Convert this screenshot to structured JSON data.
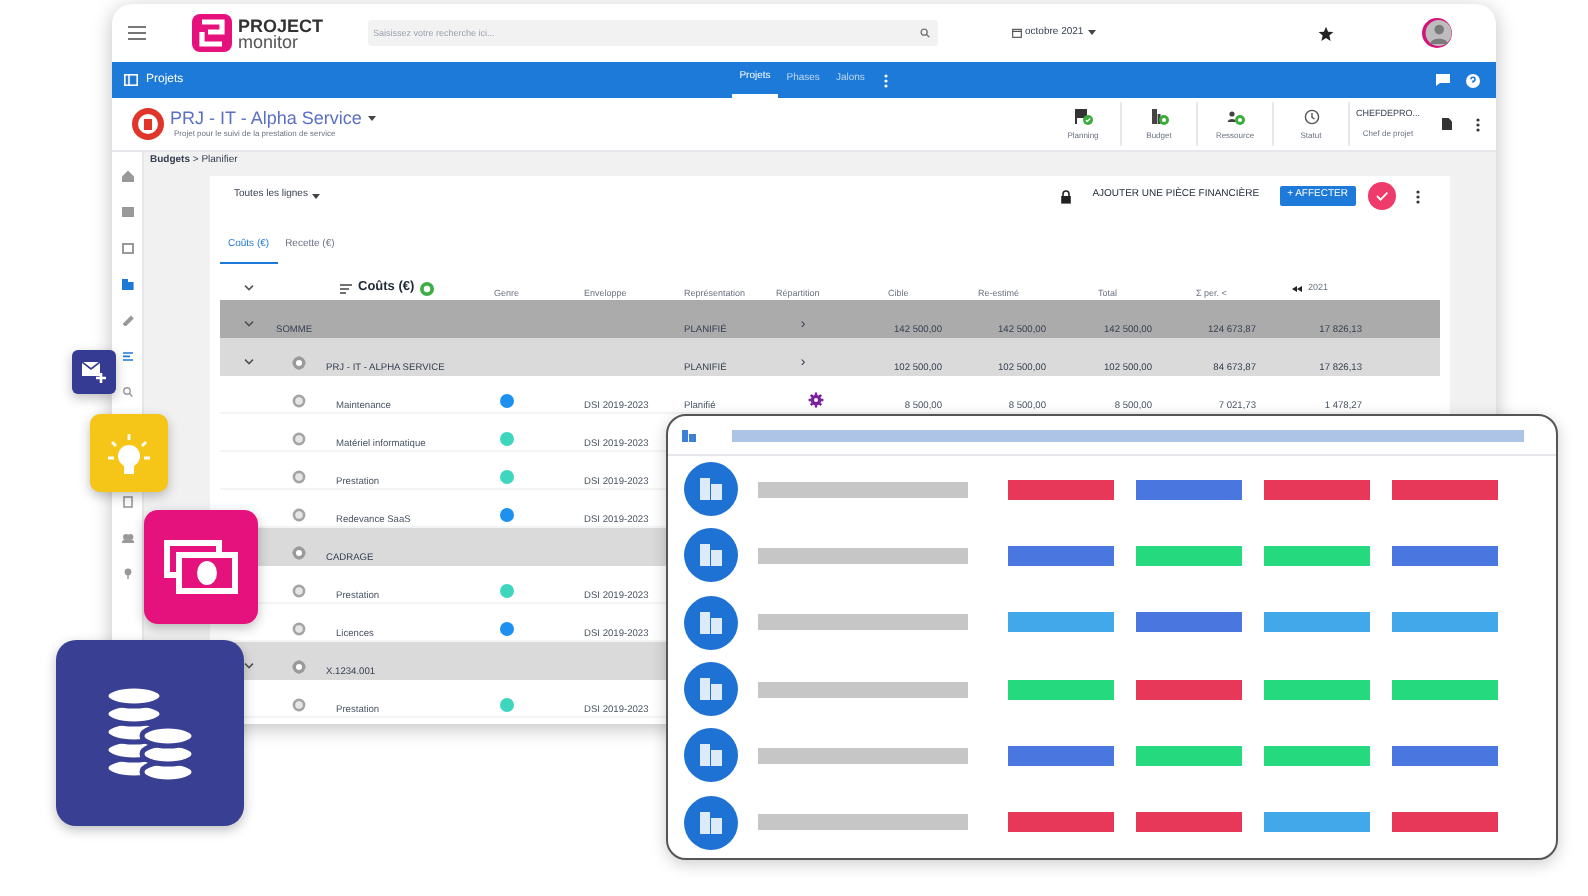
{
  "app": {
    "logo_line1": "PROJECT",
    "logo_line2": "monitor",
    "search": {
      "placeholder": "Saisissez votre recherche ici..."
    },
    "period": "octobre 2021"
  },
  "nav": {
    "title": "Projets",
    "tabs": [
      {
        "label": "Projets",
        "selected": true
      },
      {
        "label": "Phases",
        "selected": false
      },
      {
        "label": "Jalons",
        "selected": false
      }
    ]
  },
  "project": {
    "title": "PRJ - IT - Alpha Service",
    "subtitle": "Projet pour le suivi de la prestation de service",
    "actions": [
      {
        "label": "Planning",
        "kind": "flag"
      },
      {
        "label": "Budget",
        "kind": "budget"
      },
      {
        "label": "Ressource",
        "kind": "person"
      },
      {
        "label": "Statut",
        "kind": "history"
      }
    ],
    "owner": {
      "value": "CHEFDEPRO...",
      "label": "Chef de projet"
    }
  },
  "rail": {
    "top": [
      {
        "kind": "home",
        "selected": false
      },
      {
        "kind": "card",
        "selected": false
      },
      {
        "kind": "calendar",
        "selected": false
      },
      {
        "kind": "budget",
        "selected": true
      },
      {
        "kind": "edit",
        "selected": false
      },
      {
        "kind": "list",
        "selected": true
      },
      {
        "kind": "search",
        "selected": false
      }
    ],
    "bottom": [
      {
        "kind": "doc",
        "selected": false
      },
      {
        "kind": "people",
        "selected": false
      },
      {
        "kind": "pin",
        "selected": false
      }
    ]
  },
  "breadcrumb": "**Budgets** > Planifier",
  "toolbar": {
    "filter": "Toutes les lignes",
    "add_label": "AJOUTER UNE PIÈCE FINANCIÈRE",
    "assign_label": "+ AFFECTER"
  },
  "tabs": [
    {
      "label": "Coûts (€)",
      "selected": true
    },
    {
      "label": "Recette (€)",
      "selected": false
    }
  ],
  "table": {
    "columns": [
      "Coûts (€)",
      "Genre",
      "Enveloppe",
      "Représentation",
      "Répartition",
      "Cible",
      "Re-estimé",
      "Total",
      "Σ per. <",
      "2021"
    ],
    "rows": [
      {
        "kind": "total",
        "label": "SOMME",
        "representation": "PLANIFIÉ",
        "distribution": "›",
        "values": [
          "142 500,00",
          "142 500,00",
          "142 500,00",
          "124 673,87",
          "17 826,13"
        ]
      },
      {
        "kind": "group",
        "label": "PRJ - IT - ALPHA SERVICE",
        "representation": "PLANIFIÉ",
        "distribution": "›",
        "values": [
          "102 500,00",
          "102 500,00",
          "102 500,00",
          "84 673,87",
          "17 826,13"
        ]
      },
      {
        "kind": "item",
        "label": "Maintenance",
        "color": "#1e90f0",
        "envelope": "DSI 2019-2023",
        "representation": "Planifié",
        "configured": true,
        "values": [
          "8 500,00",
          "8 500,00",
          "8 500,00",
          "7 021,73",
          "1 478,27"
        ]
      },
      {
        "kind": "item",
        "label": "Matériel informatique",
        "color": "#3fd6c0",
        "envelope": "DSI 2019-2023"
      },
      {
        "kind": "item",
        "label": "Prestation",
        "color": "#3fd6c0",
        "envelope": "DSI 2019-2023"
      },
      {
        "kind": "item",
        "label": "Redevance SaaS",
        "color": "#1e90f0",
        "envelope": "DSI 2019-2023"
      },
      {
        "kind": "group",
        "label": "CADRAGE"
      },
      {
        "kind": "item",
        "label": "Prestation",
        "color": "#3fd6c0",
        "envelope": "DSI 2019-2023"
      },
      {
        "kind": "item",
        "label": "Licences",
        "color": "#1e90f0",
        "envelope": "DSI 2019-2023"
      },
      {
        "kind": "group",
        "label": "X.1234.001"
      },
      {
        "kind": "item",
        "label": "Prestation",
        "color": "#3fd6c0",
        "envelope": "DSI 2019-2023"
      }
    ]
  },
  "overlay": {
    "rows": [
      {
        "bars": [
          {
            "color": "#e8385a"
          },
          {
            "color": "#4a76e0"
          },
          {
            "color": "#e8385a"
          },
          {
            "color": "#e8385a"
          }
        ]
      },
      {
        "bars": [
          {
            "color": "#4a76e0"
          },
          {
            "color": "#25d97e"
          },
          {
            "color": "#25d97e"
          },
          {
            "color": "#4a76e0"
          }
        ]
      },
      {
        "bars": [
          {
            "color": "#42a8ea"
          },
          {
            "color": "#4a76e0"
          },
          {
            "color": "#42a8ea"
          },
          {
            "color": "#42a8ea"
          }
        ]
      },
      {
        "bars": [
          {
            "color": "#25d97e"
          },
          {
            "color": "#e8385a"
          },
          {
            "color": "#25d97e"
          },
          {
            "color": "#25d97e"
          }
        ]
      },
      {
        "bars": [
          {
            "color": "#4a76e0"
          },
          {
            "color": "#25d97e"
          },
          {
            "color": "#25d97e"
          },
          {
            "color": "#4a76e0"
          }
        ]
      },
      {
        "bars": [
          {
            "color": "#e8385a"
          },
          {
            "color": "#e8385a"
          },
          {
            "color": "#42a8ea"
          },
          {
            "color": "#e8385a"
          }
        ]
      }
    ]
  },
  "tiles": [
    {
      "kind": "mail"
    },
    {
      "kind": "idea"
    },
    {
      "kind": "money"
    },
    {
      "kind": "coins"
    }
  ]
}
